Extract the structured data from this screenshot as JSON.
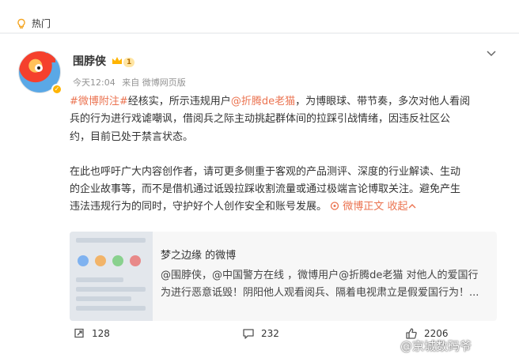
{
  "header": {
    "label": "热门",
    "icon": "hot-icon"
  },
  "post": {
    "username": "围脖侠",
    "level": "1",
    "time": "今天12:04",
    "source": "来自 微博网页版",
    "p1_topic": "#微博附注#",
    "p1_a": "经核实，所示违规用户",
    "p1_mention": "@折腾de老猫",
    "p1_b1": "，为博眼球、带节奏，多次对他人看阅",
    "p1_b2": "兵的行为进行戏谑嘲讽，借阅兵之际主动挑起群体间的拉踩引战情绪，因违反社区公",
    "p1_b3": "约，目前已处于禁言状态。",
    "p2_1": "在此也呼吁广大内容创作者，请可更多侧重于客观的产品测评、深度的行业解读、生动",
    "p2_2": "的企业故事等，而不是借机通过诋毁拉踩收割流量或通过极端言论博取关注。避免产生",
    "p2_3": "违法违规行为的同时，守护好个人创作安全和账号发展。",
    "full_text_link": "微博正文",
    "collapse_link": "收起"
  },
  "retweet": {
    "title": "梦之边缘 的微博",
    "line1": "@围脖侠，@中国警方在线 ，微博用户@折腾de老猫 对他人的爱国行",
    "line2": "为进行恶意诋毁！阴阳他人观看阅兵、隔着电视肃立是假爱国行为！..."
  },
  "actions": {
    "repost_count": "128",
    "comment_count": "232",
    "like_count": "2206"
  },
  "watermark": "@京城数码爷",
  "colors": {
    "accent": "#eb7350",
    "background": "#eff1f4",
    "meta": "#939393"
  }
}
